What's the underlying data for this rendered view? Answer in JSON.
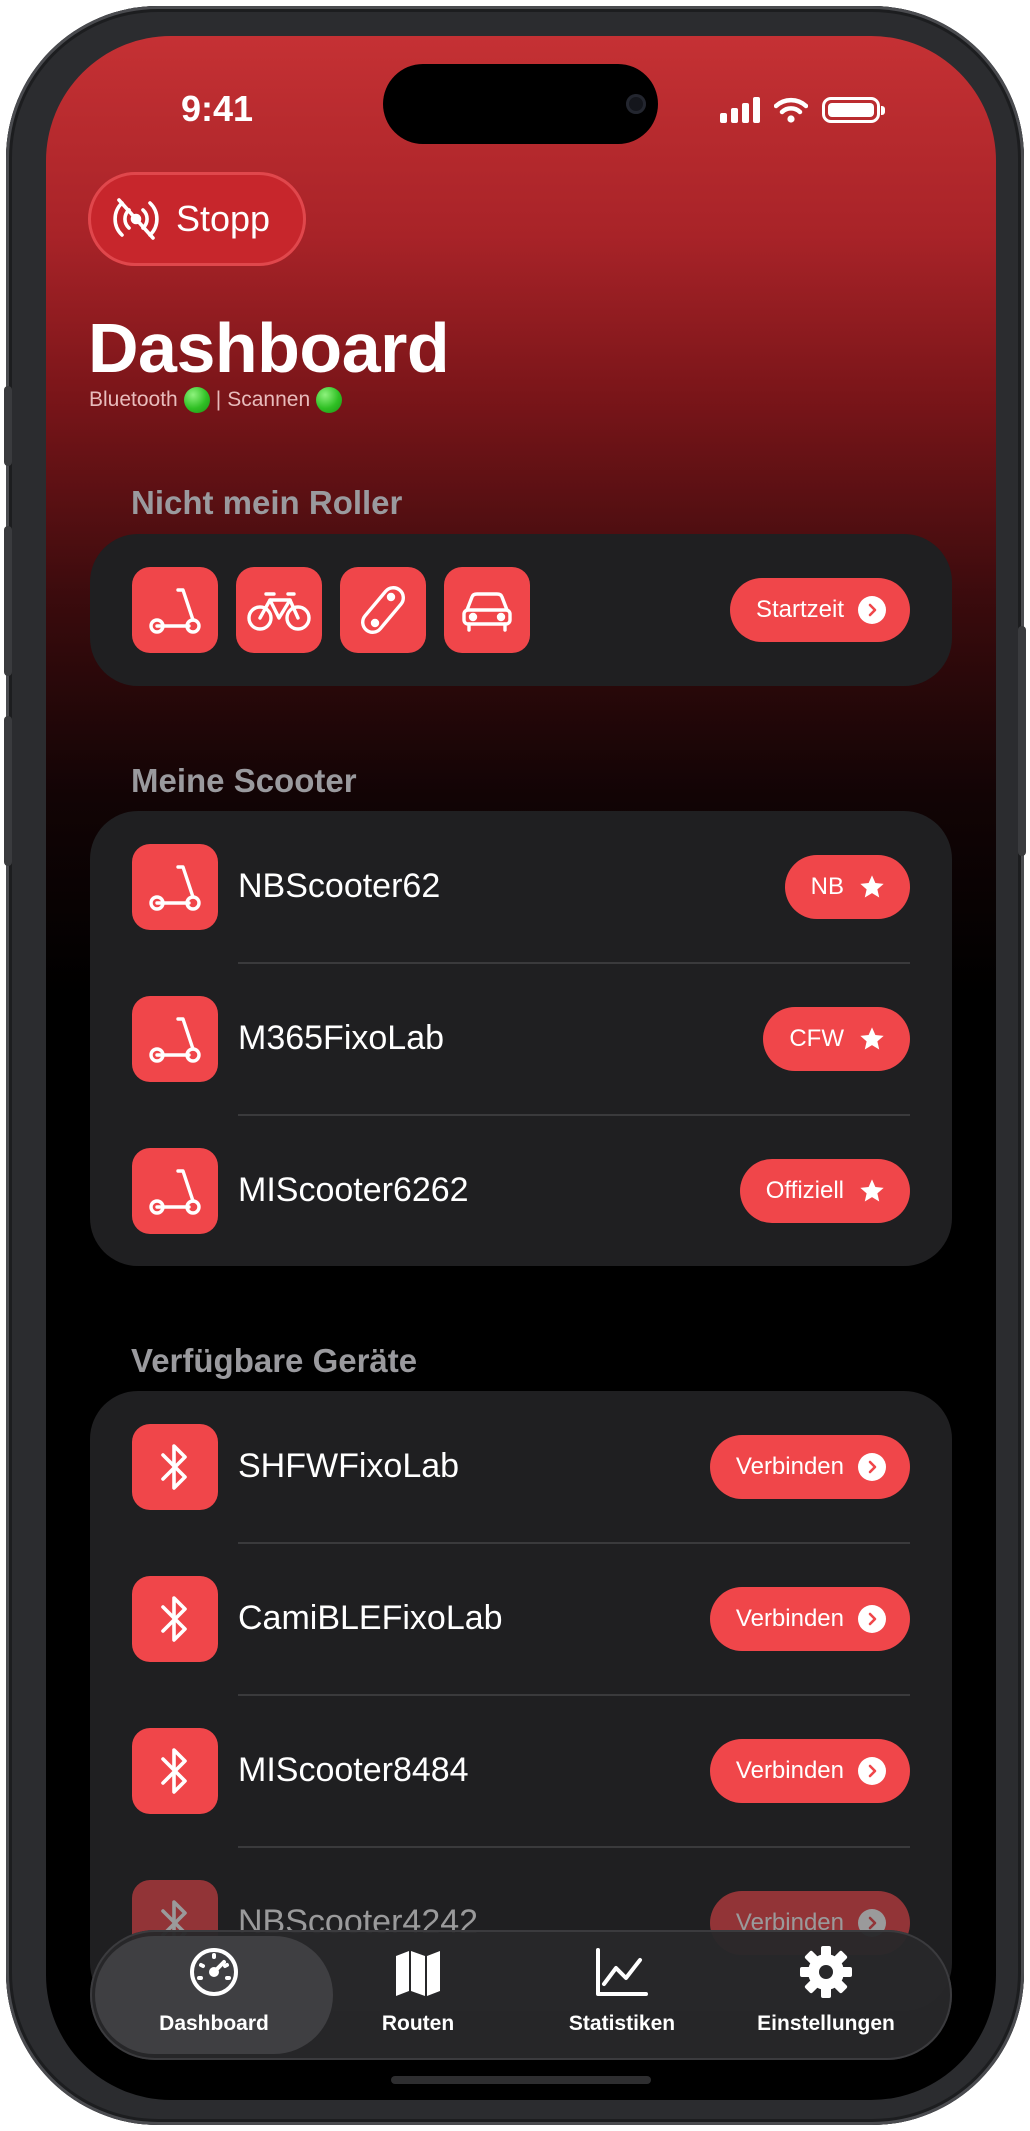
{
  "status_bar": {
    "time": "9:41",
    "icons": [
      "cellular-icon",
      "wifi-icon",
      "battery-icon"
    ]
  },
  "header": {
    "stop_label": "Stopp",
    "title": "Dashboard",
    "bluetooth_label": "Bluetooth",
    "separator": "|",
    "scan_label": "Scannen"
  },
  "not_my_scooter": {
    "title": "Nicht mein Roller",
    "vehicle_icons": [
      "scooter-icon",
      "bicycle-icon",
      "skateboard-icon",
      "car-icon"
    ],
    "start_time_label": "Startzeit"
  },
  "my_scooters": {
    "title": "Meine Scooter",
    "items": [
      {
        "name": "NBScooter62",
        "badge": "NB"
      },
      {
        "name": "M365FixoLab",
        "badge": "CFW"
      },
      {
        "name": "MIScooter6262",
        "badge": "Offiziell"
      }
    ]
  },
  "available_devices": {
    "title": "Verfügbare Geräte",
    "items": [
      {
        "name": "SHFWFixoLab",
        "action": "Verbinden"
      },
      {
        "name": "CamiBLEFixoLab",
        "action": "Verbinden"
      },
      {
        "name": "MIScooter8484",
        "action": "Verbinden"
      },
      {
        "name": "NBScooter4242",
        "action": "Verbinden"
      }
    ]
  },
  "tabbar": {
    "tabs": [
      {
        "label": "Dashboard",
        "icon": "speedometer-icon",
        "active": true
      },
      {
        "label": "Routen",
        "icon": "map-icon",
        "active": false
      },
      {
        "label": "Statistiken",
        "icon": "chart-icon",
        "active": false
      },
      {
        "label": "Einstellungen",
        "icon": "gear-icon",
        "active": false
      }
    ]
  },
  "colors": {
    "accent": "#f0464a",
    "header_red": "#c53134",
    "card": "#1f1f21",
    "active_dot": "#2fc024"
  }
}
